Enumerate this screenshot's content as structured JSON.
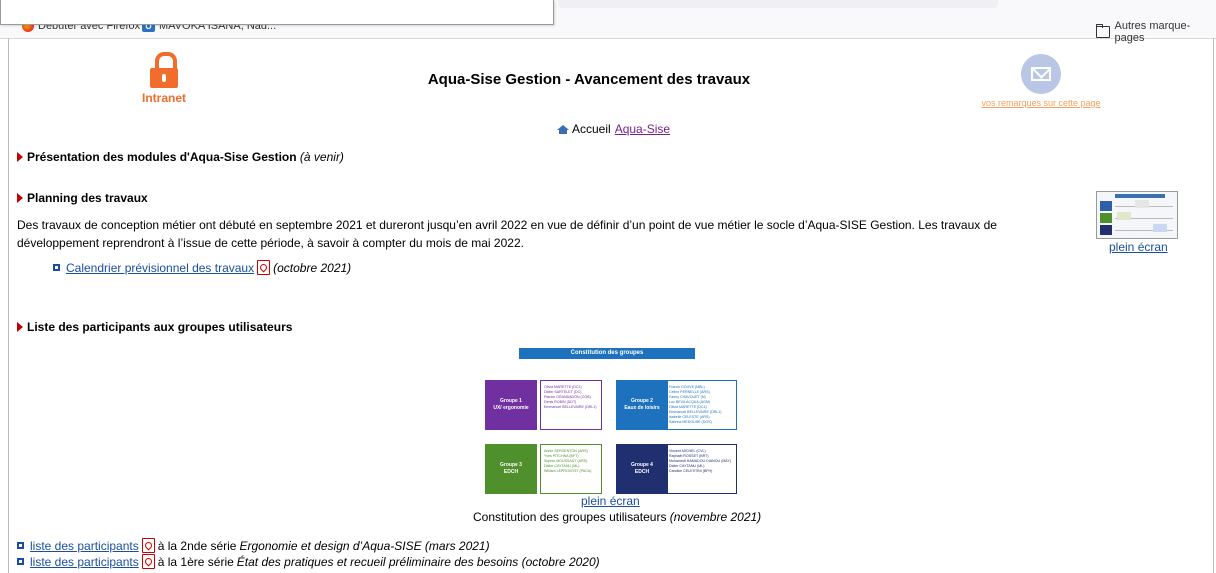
{
  "browser": {
    "bookmarks": [
      {
        "label": "Débuter avec Firefox",
        "icon": "firefox-icon"
      },
      {
        "label": "MAVOKA ISANA, Nad...",
        "icon": "outlook-icon"
      }
    ],
    "other_bookmarks": "Autres marque-pages"
  },
  "header": {
    "intranet_label": "Intranet",
    "title": "Aqua-Sise Gestion - Avancement des travaux",
    "feedback_link": "vos remarques sur cette page"
  },
  "breadcrumb": {
    "home_label": "Accueil",
    "home_link": "Aqua-Sise"
  },
  "sections": {
    "presentation": {
      "title": "Présentation des modules d'Aqua-Sise Gestion",
      "note": "(à venir)"
    },
    "planning": {
      "title": "Planning des travaux",
      "text": "Des travaux de conception métier ont débuté en septembre 2021 et dureront jusqu’en avril 2022 en vue de définir d’un point de vue métier le socle d’Aqua-SISE Gestion. Les travaux de développement reprendront à l’issue de cette période, à savoir à compter du mois de mai 2022.",
      "calendar_link": "Calendrier prévisionnel des travaux",
      "calendar_date": "(octobre 2021)",
      "fullscreen": "plein écran"
    },
    "participants": {
      "title": "Liste des participants aux groupes utilisateurs",
      "figure": {
        "header": "Constitution des groupes",
        "groups": [
          {
            "name": "Groupe 1",
            "sub": "UX/ ergonomie",
            "color": "#7030a0",
            "members": [
              "Olivia MARETTE (DC1)",
              "Didier SARTELET (DC)",
              "Patrice GRANDADON (CGB)",
              "Denis ROBIN (DDT)",
              "Emmanuel BELLEVAIRE (DRL1)"
            ]
          },
          {
            "name": "Groupe 2",
            "sub": "Eaux de loisirs",
            "color": "#1e71bd",
            "members": [
              "Franck GOUVE (MBL)",
              "Céline PERNELLE (ARS)",
              "Fanny CHAVOUET (N)",
              "Luc BEVILACQUA (AGM)",
              "Olivia MARETTE (DC1)",
              "Emmanuel BELLEVAIRE (DRL1)",
              "Isabelle CELESTE (ARS)",
              "Sabrina MEDOUSE (DGS)"
            ]
          },
          {
            "name": "Groupe 3",
            "sub": "EDCH",
            "color": "#4f8f2c",
            "members": [
              "Annie SERGENTON (ARS)",
              "Yves PITCHNA (BFT)",
              "Sophie MOUSSAUT (ARS)",
              "Didier CAYTANU (ML)",
              "William LEPROVOST (PACA)"
            ]
          },
          {
            "name": "Groupe 4",
            "sub": "EDCH",
            "color": "#1f2f6f",
            "members": [
              "Vincent MICHEL (CVL)",
              "Raphaël ROSSET (BRT)",
              "Mohamedi HAMADOU DIANOU (MAY)",
              "Didier CAYTANU (ML)",
              "Candice CELESTINI (BFH)"
            ]
          }
        ]
      },
      "fullscreen": "plein écran",
      "caption": "Constitution des groupes utilisateurs",
      "caption_date": "(novembre 2021)",
      "lists": [
        {
          "link": "liste des participants",
          "text": "à la 2nde série",
          "italic": "Ergonomie et design d’Aqua-SISE (mars 2021)"
        },
        {
          "link": "liste des participants",
          "text": "à la 1ère série",
          "italic": "État des pratiques et recueil préliminaire des besoins (octobre 2020)"
        }
      ]
    }
  }
}
